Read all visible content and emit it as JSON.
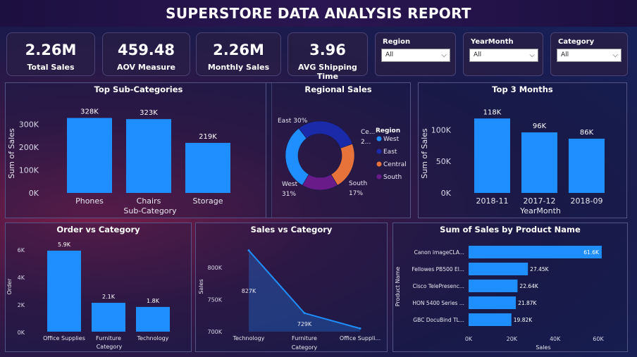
{
  "title": "SUPERSTORE DATA ANALYSIS REPORT",
  "kpis": [
    {
      "value": "2.26M",
      "label": "Total Sales"
    },
    {
      "value": "459.48",
      "label": "AOV Measure"
    },
    {
      "value": "2.26M",
      "label": "Monthly Sales"
    },
    {
      "value": "3.96",
      "label": "AVG Shipping Time"
    }
  ],
  "slicers": [
    {
      "title": "Region",
      "selected": "All"
    },
    {
      "title": "YearMonth",
      "selected": "All"
    },
    {
      "title": "Category",
      "selected": "All"
    }
  ],
  "colors": {
    "bar": "#1f8fff",
    "donut_west": "#1f8fff",
    "donut_east": "#1a2aa8",
    "donut_central": "#e8733a",
    "donut_south": "#6a1b8a"
  },
  "chart_data": [
    {
      "type": "bar",
      "title": "Top Sub-Categories",
      "xlabel": "Sub-Category",
      "ylabel": "Sum of Sales",
      "categories": [
        "Phones",
        "Chairs",
        "Storage"
      ],
      "values": [
        328000,
        323000,
        219000
      ],
      "data_labels": [
        "328K",
        "323K",
        "219K"
      ],
      "yticks": [
        {
          "v": 0,
          "t": "0K"
        },
        {
          "v": 100000,
          "t": "100K"
        },
        {
          "v": 200000,
          "t": "200K"
        },
        {
          "v": 300000,
          "t": "300K"
        }
      ],
      "ylim": [
        0,
        345000
      ]
    },
    {
      "type": "pie",
      "title": "Regional Sales",
      "legend_title": "Region",
      "legend": [
        "West",
        "East",
        "Central",
        "South"
      ],
      "slices": [
        {
          "name": "West",
          "value": 31,
          "label_name": "West",
          "label_pct": "31%"
        },
        {
          "name": "East",
          "value": 30,
          "label_name": "East 30%",
          "label_pct": ""
        },
        {
          "name": "Central",
          "value": 22,
          "label_name": "Ce...",
          "label_pct": "2..."
        },
        {
          "name": "South",
          "value": 17,
          "label_name": "South",
          "label_pct": "17%"
        }
      ]
    },
    {
      "type": "bar",
      "title": "Top 3 Months",
      "xlabel": "YearMonth",
      "ylabel": "Sum of Sales",
      "categories": [
        "2018-11",
        "2017-12",
        "2018-09"
      ],
      "values": [
        118000,
        96000,
        86000
      ],
      "data_labels": [
        "118K",
        "96K",
        "86K"
      ],
      "yticks": [
        {
          "v": 0,
          "t": "0K"
        },
        {
          "v": 50000,
          "t": "50K"
        },
        {
          "v": 100000,
          "t": "100K"
        }
      ],
      "ylim": [
        0,
        125000
      ]
    },
    {
      "type": "bar",
      "title": "Order vs Category",
      "xlabel": "Category",
      "ylabel": "Order",
      "categories": [
        "Office Supplies",
        "Furniture",
        "Technology"
      ],
      "values": [
        5900,
        2100,
        1800
      ],
      "data_labels": [
        "5.9K",
        "2.1K",
        "1.8K"
      ],
      "yticks": [
        {
          "v": 0,
          "t": "0K"
        },
        {
          "v": 2000,
          "t": "2K"
        },
        {
          "v": 4000,
          "t": "4K"
        },
        {
          "v": 6000,
          "t": "6K"
        }
      ],
      "ylim": [
        0,
        6000
      ]
    },
    {
      "type": "area",
      "title": "Sales vs Category",
      "xlabel": "Category",
      "ylabel": "Sales",
      "categories": [
        "Technology",
        "Furniture",
        "Office Suppli..."
      ],
      "values": [
        827000,
        729000,
        705000
      ],
      "data_labels": [
        "827K",
        "729K",
        ""
      ],
      "yticks": [
        {
          "v": 700000,
          "t": "700K"
        },
        {
          "v": 750000,
          "t": "750K"
        },
        {
          "v": 800000,
          "t": "800K"
        }
      ],
      "ylim": [
        700000,
        842000
      ]
    },
    {
      "type": "bar",
      "orientation": "horizontal",
      "title": "Sum of Sales by Product Name",
      "xlabel": "Sales",
      "ylabel": "Product Name",
      "categories": [
        "Canon imageCLA...",
        "Fellowes PB500 El...",
        "Cisco TelePresenc...",
        "HON 5400 Series ...",
        "GBC DocuBind TL..."
      ],
      "values": [
        61600,
        27450,
        22640,
        21870,
        19820
      ],
      "data_labels": [
        "61.6K",
        "27.45K",
        "22.64K",
        "21.87K",
        "19.82K"
      ],
      "xticks": [
        {
          "v": 0,
          "t": "0K"
        },
        {
          "v": 20000,
          "t": "20K"
        },
        {
          "v": 40000,
          "t": "40K"
        },
        {
          "v": 60000,
          "t": "60K"
        }
      ],
      "xlim": [
        0,
        60000
      ]
    }
  ]
}
